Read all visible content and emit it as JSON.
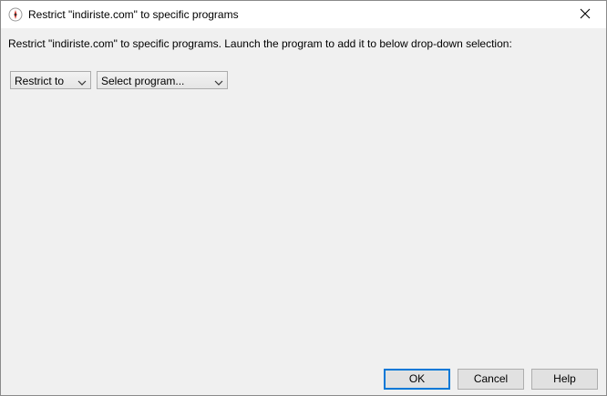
{
  "window": {
    "title": "Restrict \"indiriste.com\" to specific programs",
    "close_glyph": "✕"
  },
  "instruction": "Restrict \"indiriste.com\" to specific programs. Launch the program to add it to below drop-down selection:",
  "restriction_select": {
    "value": "Restrict to"
  },
  "program_select": {
    "value": "Select program..."
  },
  "buttons": {
    "ok": "OK",
    "cancel": "Cancel",
    "help": "Help"
  },
  "colors": {
    "default_button_border": "#0078d7",
    "dialog_background": "#f0f0f0"
  },
  "icons": {
    "app": "app-shield-icon",
    "close": "close-icon",
    "dropdown": "chevron-down-icon"
  }
}
